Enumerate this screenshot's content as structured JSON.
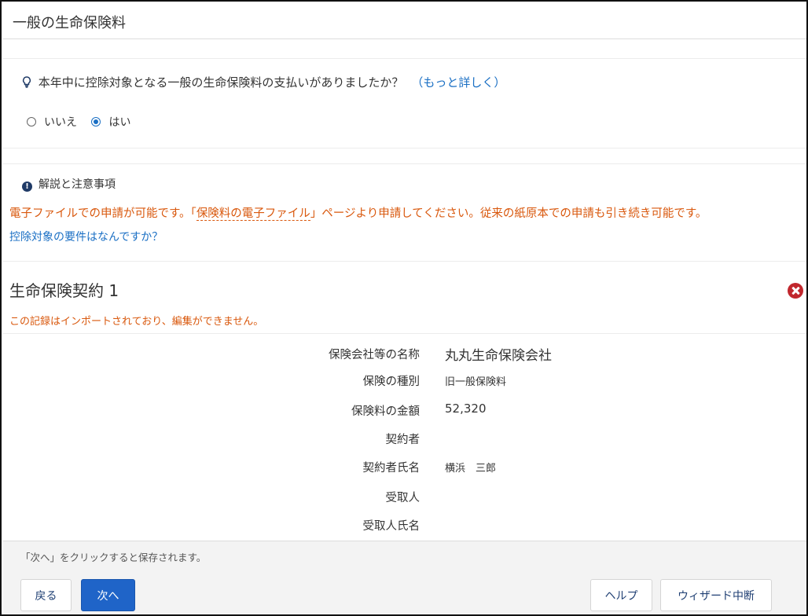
{
  "page": {
    "title": "一般の生命保険料"
  },
  "question": {
    "text": "本年中に控除対象となる一般の生命保険料の支払いがありましたか？",
    "more_link": "（もっと詳しく）",
    "icon": "lightbulb-icon",
    "options": [
      {
        "label": "いいえ",
        "selected": false
      },
      {
        "label": "はい",
        "selected": true
      }
    ]
  },
  "notes": {
    "heading": "解説と注意事項",
    "icon": "info-icon",
    "body_pre": "電子ファイルでの申請が可能です。「",
    "body_link": "保険料の電子ファイル",
    "body_post": "」ページより申請してください。従来の紙原本での申請も引き続き可能です。",
    "requirements_link": "控除対象の要件はなんですか？"
  },
  "contract": {
    "title": "生命保険契約 1",
    "warning": "この記録はインポートされており、編集ができません。",
    "delete_icon": "close-circle-icon",
    "fields": [
      {
        "label": "保険会社等の名称",
        "value": "丸丸生命保険会社"
      },
      {
        "label": "保険の種別",
        "value": "旧一般保険料"
      },
      {
        "label": "保険料の金額",
        "value": "52,320"
      },
      {
        "label": "契約者",
        "value": ""
      },
      {
        "label": "契約者氏名",
        "value": "横浜　三郎"
      },
      {
        "label": "受取人",
        "value": ""
      },
      {
        "label": "受取人氏名",
        "value": ""
      }
    ]
  },
  "footer": {
    "hint": "「次へ」をクリックすると保存されます。",
    "back": "戻る",
    "next": "次へ",
    "help": "ヘルプ",
    "abort": "ウィザード中断"
  },
  "colors": {
    "accent": "#1f64c8",
    "link": "#1a6fc4",
    "warning": "#d9580d",
    "delete": "#c1272d"
  }
}
